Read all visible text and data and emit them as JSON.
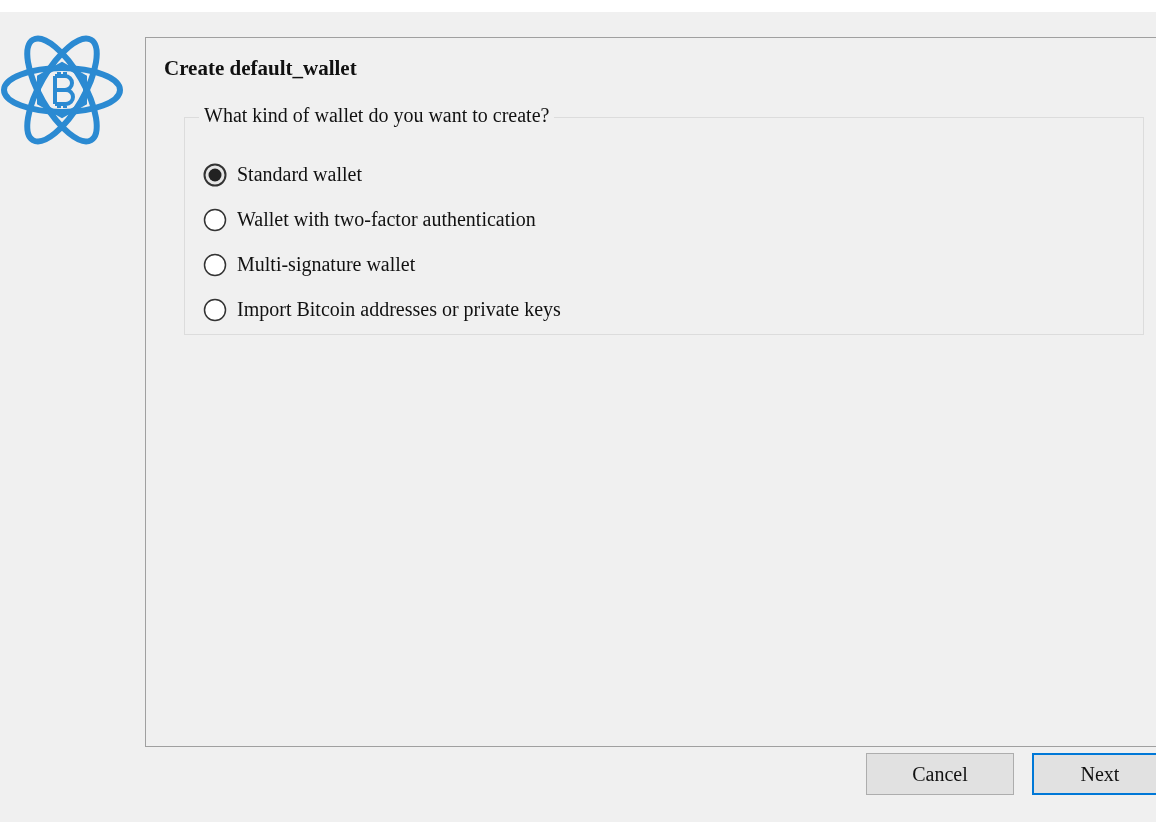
{
  "title": "Create default_wallet",
  "group": {
    "legend": "What kind of wallet do you want to create?",
    "options": [
      {
        "label": "Standard wallet",
        "selected": true
      },
      {
        "label": "Wallet with two-factor authentication",
        "selected": false
      },
      {
        "label": "Multi-signature wallet",
        "selected": false
      },
      {
        "label": "Import Bitcoin addresses or private keys",
        "selected": false
      }
    ]
  },
  "buttons": [
    {
      "label": "Cancel",
      "default": false
    },
    {
      "label": "Next",
      "default": true
    }
  ]
}
